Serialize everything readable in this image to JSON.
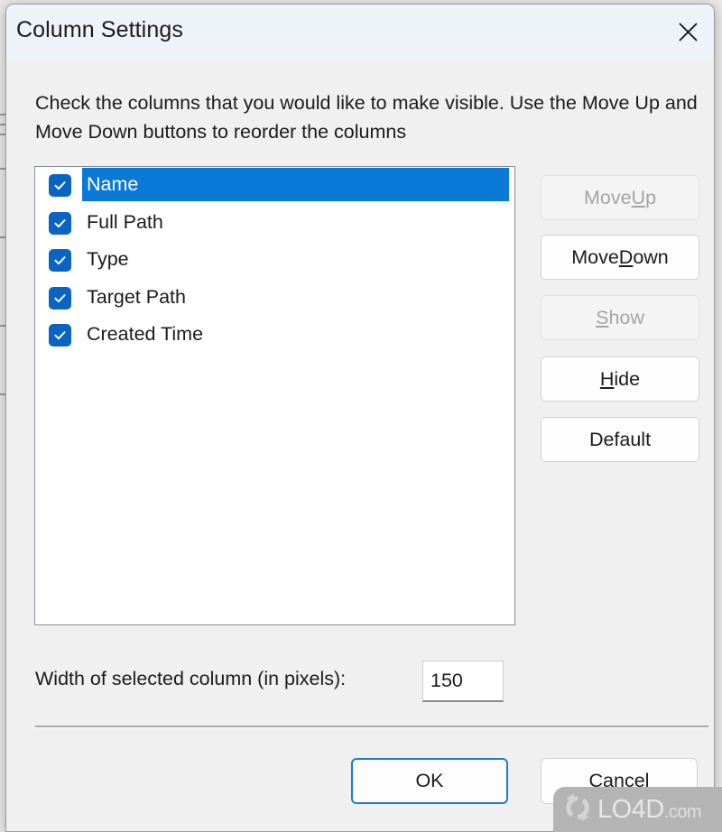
{
  "window": {
    "title": "Column Settings",
    "close_icon": "close-x-icon"
  },
  "instruction": "Check the columns that you would like to make visible. Use the Move Up and Move Down buttons to reorder the columns",
  "column_list": {
    "items": [
      {
        "label": "Name",
        "checked": true,
        "selected": true
      },
      {
        "label": "Full Path",
        "checked": true,
        "selected": false
      },
      {
        "label": "Type",
        "checked": true,
        "selected": false
      },
      {
        "label": "Target Path",
        "checked": true,
        "selected": false
      },
      {
        "label": "Created Time",
        "checked": true,
        "selected": false
      }
    ],
    "checkbox_icon": "checkmark-icon",
    "selection_color": "#0b7ad6",
    "checkbox_color": "#0a65c2"
  },
  "side_buttons": [
    {
      "label_pre": "Move ",
      "mnemonic": "U",
      "label_post": "p",
      "full": "Move Up",
      "enabled": false
    },
    {
      "label_pre": "Move ",
      "mnemonic": "D",
      "label_post": "own",
      "full": "Move Down",
      "enabled": true
    },
    {
      "label_pre": "",
      "mnemonic": "S",
      "label_post": "how",
      "full": "Show",
      "enabled": false
    },
    {
      "label_pre": "",
      "mnemonic": "H",
      "label_post": "ide",
      "full": "Hide",
      "enabled": true
    },
    {
      "label_pre": "",
      "mnemonic": "",
      "label_post": "Default",
      "full": "Default",
      "enabled": true
    }
  ],
  "width_setting": {
    "label": "Width of selected column (in pixels):",
    "value": "150",
    "placeholder": ""
  },
  "bottom_buttons": {
    "ok_label": "OK",
    "cancel_label": "Cancel",
    "default_focus": "OK",
    "focus_color": "#1f7ad4"
  },
  "watermark": {
    "text": "LO4D",
    "suffix": ".com",
    "logo_icon": "circular-arrows-icon"
  }
}
